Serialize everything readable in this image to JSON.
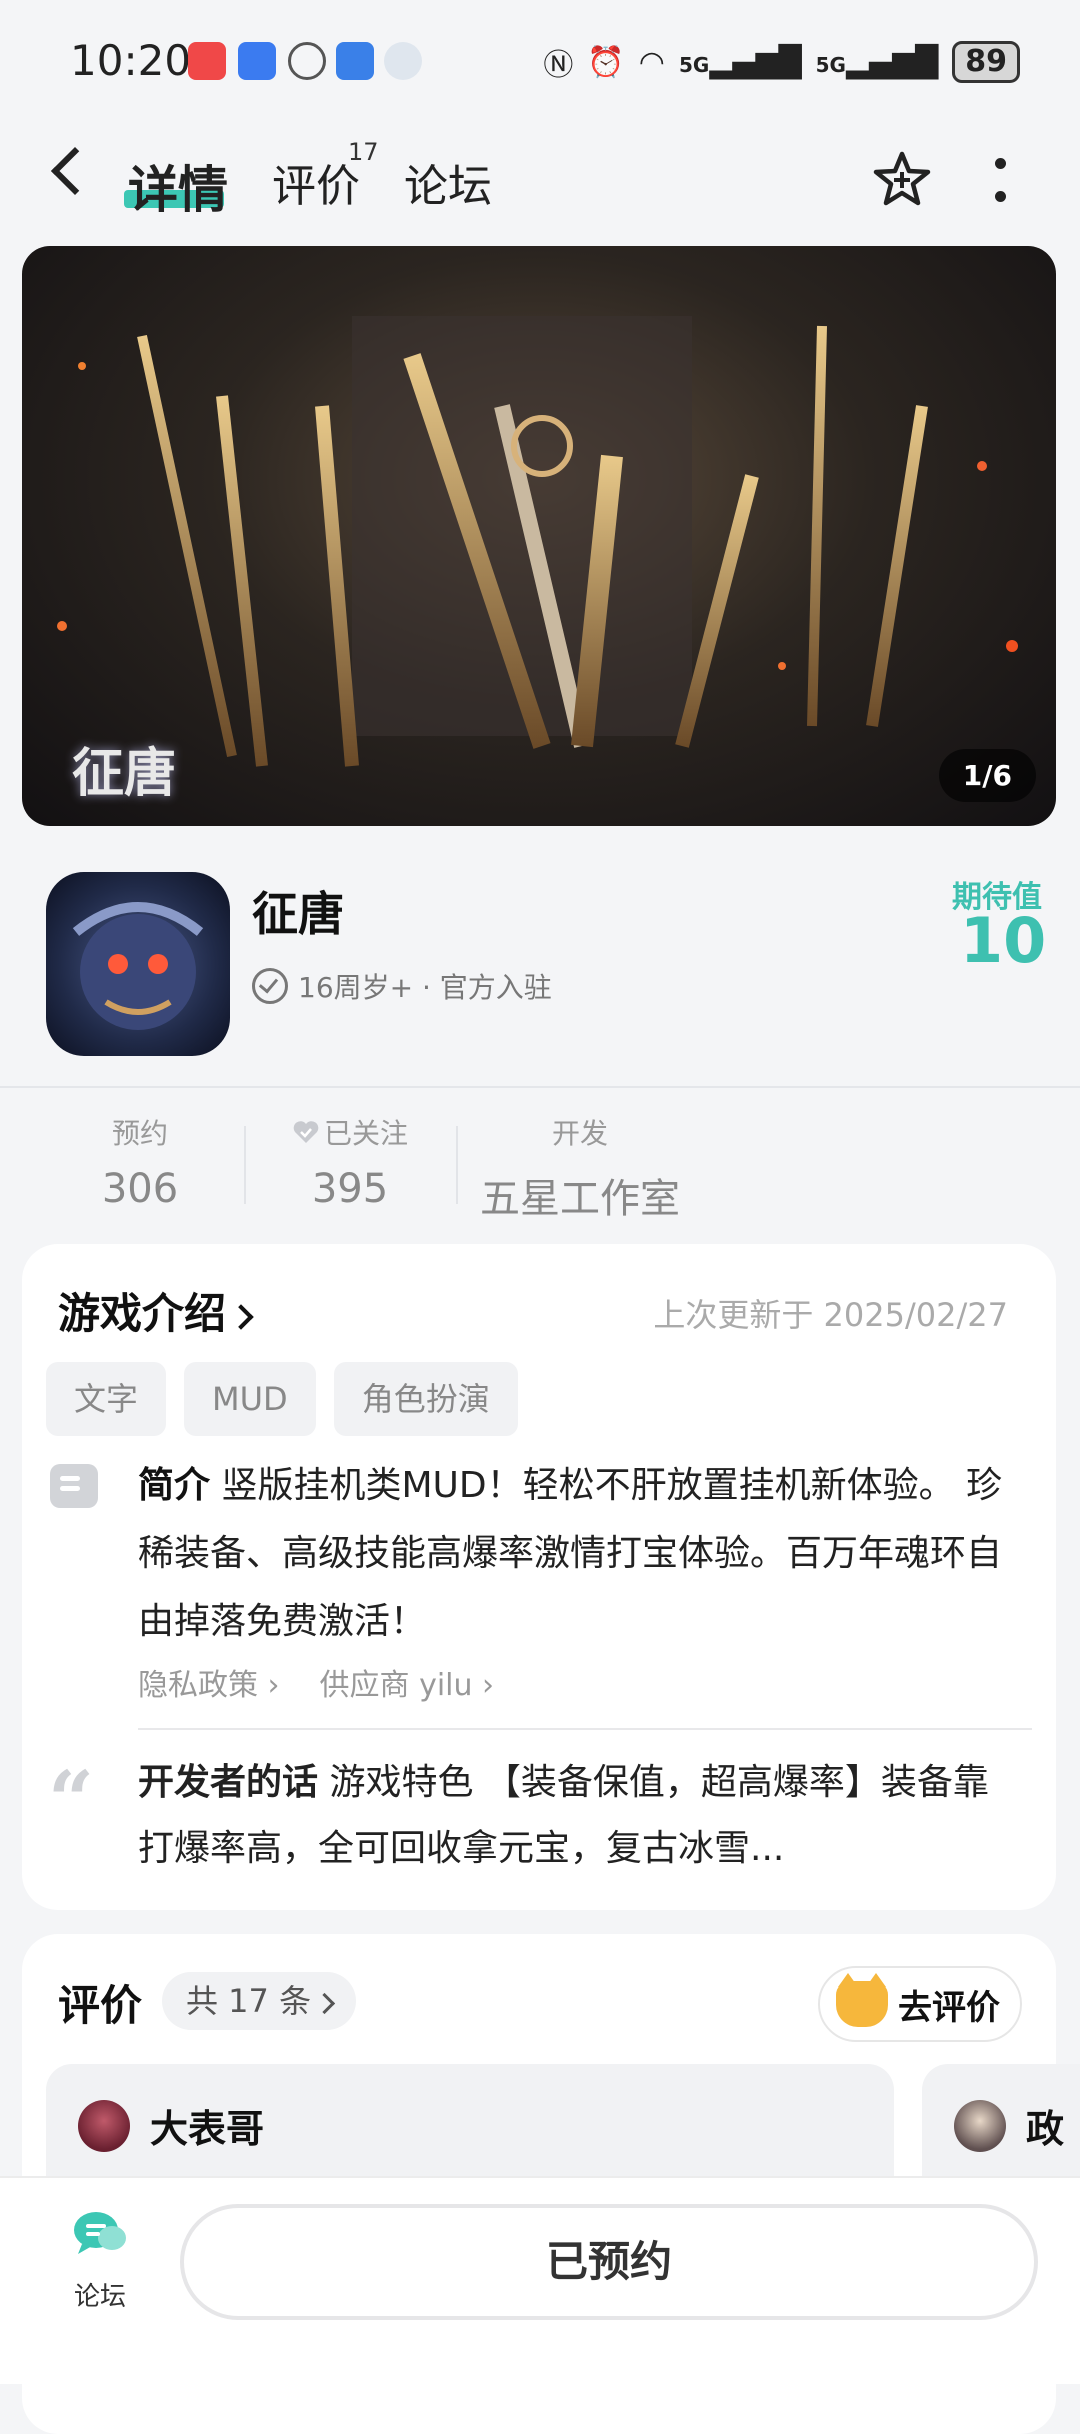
{
  "status_bar": {
    "time": "10:20",
    "battery": "89",
    "net1": "5G",
    "net2": "5G"
  },
  "nav": {
    "tab_details": "详情",
    "tab_reviews": "评价",
    "tab_reviews_badge": "17",
    "tab_forum": "论坛"
  },
  "banner": {
    "pager": "1/6",
    "logo_text": "征唐"
  },
  "app": {
    "name": "征唐",
    "meta": "16周岁+ · 官方入驻",
    "expect_label": "期待值",
    "expect_value": "10"
  },
  "stats": {
    "reserve_label": "预约",
    "reserve_value": "306",
    "follow_label": "已关注",
    "follow_value": "395",
    "dev_label": "开发",
    "dev_value": "五星工作室"
  },
  "intro": {
    "title": "游戏介绍",
    "updated": "上次更新于 2025/02/27",
    "tags": [
      "文字",
      "MUD",
      "角色扮演"
    ],
    "desc_label": "简介",
    "desc_text": "竖版挂机类MUD！轻松不肝放置挂机新体验。 珍稀装备、高级技能高爆率激情打宝体验。百万年魂环自由掉落免费激活！",
    "privacy_link": "隐私政策 ›",
    "supplier_link": "供应商 yilu ›",
    "dev_label": "开发者的话",
    "dev_text": "游戏特色 【装备保值，超高爆率】装备靠打爆率高，全可回收拿元宝，复古冰雪..."
  },
  "reviews": {
    "title": "评价",
    "count": "共 17 条",
    "go_review": "去评价",
    "items": [
      {
        "name": "大表哥"
      },
      {
        "name": "政"
      }
    ]
  },
  "bottom": {
    "forum_label": "论坛",
    "reserve_button": "已预约"
  },
  "colors": {
    "accent": "#3cc7b4",
    "background": "#f4f5f7"
  }
}
